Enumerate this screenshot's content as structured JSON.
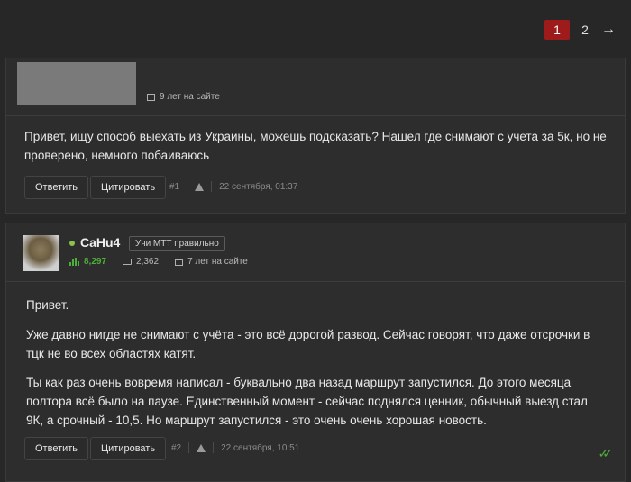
{
  "pagination": {
    "pages": [
      "1",
      "2"
    ],
    "active": "1",
    "next": "→"
  },
  "post1": {
    "years": "9 лет на сайте",
    "text": "Привет, ищу способ выехать из Украины, можешь подсказать? Нашел где снимают с учета за 5к, но не проверено, немного побаиваюсь",
    "reply_label": "Ответить",
    "quote_label": "Цитировать",
    "number": "#1",
    "date": "22 сентября, 01:37"
  },
  "post2": {
    "username": "CaHu4",
    "badge": "Учи МТТ правильно",
    "rating": "8,297",
    "messages": "2,362",
    "years": "7 лет на сайте",
    "p1": "Привет.",
    "p2": "Уже давно нигде не снимают с учёта - это всё дорогой развод. Сейчас говорят, что даже отсрочки в тцк не во всех областях катят.",
    "p3": "Ты как раз очень вовремя написал - буквально два назад маршрут запустился. До этого месяца полтора всё было на паузе. Единственный момент - сейчас поднялся ценник, обычный выезд стал 9К, а срочный - 10,5. Но маршрут запустился - это очень очень хорошая новость.",
    "reply_label": "Ответить",
    "quote_label": "Цитировать",
    "number": "#2",
    "date": "22 сентября, 10:51"
  },
  "colors": {
    "accent": "#9e1b1b",
    "green": "#4fae3a",
    "background": "#272727"
  },
  "icons": [
    "calendar-icon",
    "message-icon",
    "rating-icon",
    "warning-icon",
    "double-check-icon",
    "arrow-right-icon"
  ]
}
